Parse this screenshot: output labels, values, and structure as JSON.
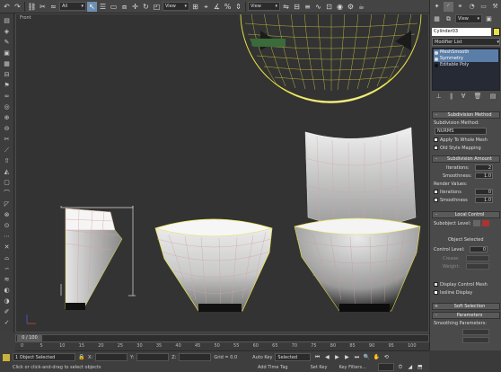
{
  "toolbar": {
    "selection_filter": "All",
    "reference_coord": "View",
    "named_selection": "View",
    "icons": [
      "undo-icon",
      "redo-icon",
      "link-icon",
      "unlink-icon",
      "bind-icon",
      "filter-dropdown",
      "select-icon",
      "select-by-name-icon",
      "rect-region-icon",
      "window-crossing-icon",
      "move-icon",
      "rotate-icon",
      "scale-icon",
      "coord-dropdown",
      "pivot-icon",
      "snap-icon",
      "angle-snap-icon",
      "percent-snap-icon",
      "spinner-snap-icon",
      "mirror-icon",
      "align-icon",
      "layer-icon",
      "curve-editor-icon",
      "schematic-icon",
      "material-editor-icon",
      "render-setup-icon",
      "render-icon"
    ]
  },
  "viewport": {
    "label": "Front",
    "axis_gizmo": "z-x"
  },
  "command_panel": {
    "tabs": [
      "create-tab",
      "modify-tab",
      "hierarchy-tab",
      "motion-tab",
      "display-tab",
      "utilities-tab"
    ],
    "view_dropdown": "View",
    "object_name": "Cylinder03",
    "object_color": "#e8e044",
    "modifier_list": "Modifier List",
    "stack": [
      {
        "label": "MeshSmooth",
        "selected": true
      },
      {
        "label": "Symmetry",
        "selected": true
      },
      {
        "label": "Editable Poly",
        "selected": false
      }
    ],
    "rollouts": {
      "subdivision_method": "Subdivision Method",
      "subdivision_method_label": "Subdivision Method:",
      "method_value": "NURMS",
      "apply_whole_mesh": "Apply To Whole Mesh",
      "old_style_mapping": "Old Style Mapping",
      "subdivision_amount": "Subdivision Amount",
      "iterations_label": "Iterations:",
      "iterations_value": "2",
      "smoothness_label": "Smoothness:",
      "smoothness_value": "1.0",
      "render_values": "Render Values:",
      "render_iterations_label": "Iterations",
      "render_iterations_value": "0",
      "render_smoothness_label": "Smoothness",
      "render_smoothness_value": "1.0",
      "local_control": "Local Control",
      "subobject_level_label": "Subobject Level:",
      "object_selected": "Object Selected",
      "control_level_label": "Control Level:",
      "control_level_value": "0",
      "crease_label": "Crease:",
      "weight_label": "Weight:",
      "display_control_mesh": "Display Control Mesh",
      "isoline_display": "Isoline Display",
      "soft_selection": "Soft Selection",
      "parameters": "Parameters",
      "smoothing_parameters": "Smoothing Parameters:"
    }
  },
  "timeline": {
    "frame_readout": "0 / 100",
    "ticks": [
      "0",
      "5",
      "10",
      "15",
      "20",
      "25",
      "30",
      "35",
      "40",
      "45",
      "50",
      "55",
      "60",
      "65",
      "70",
      "75",
      "80",
      "85",
      "90",
      "95",
      "100"
    ]
  },
  "status": {
    "objects_selected": "1 Object Selected",
    "prompt": "Click or click-and-drag to select objects",
    "x_label": "X:",
    "y_label": "Y:",
    "z_label": "Z:",
    "grid": "Grid = 0.0",
    "add_time_tag": "Add Time Tag",
    "auto_key": "Auto Key",
    "selected": "Selected",
    "set_key": "Set Key",
    "key_filters": "Key Filters..."
  },
  "colors": {
    "viewport_bg": "#333333",
    "selection_yellow": "#e8e044",
    "highlight_blue": "#5b7ea8"
  }
}
